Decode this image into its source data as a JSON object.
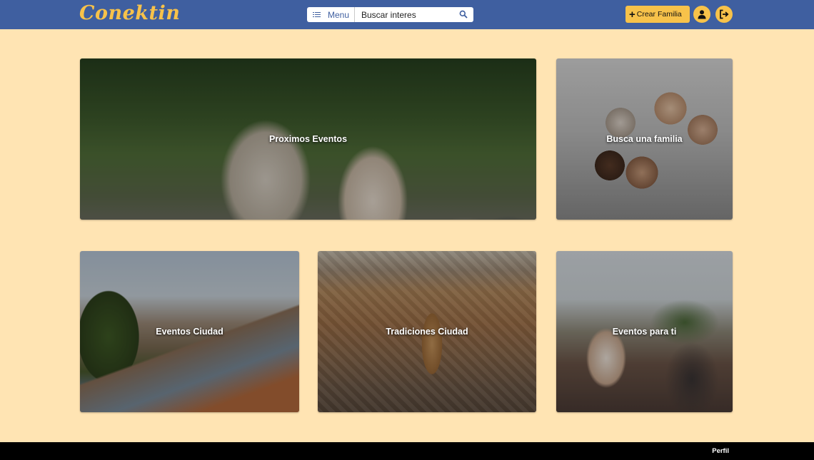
{
  "header": {
    "logo": "Conektin",
    "menu_label": "Menu",
    "search_placeholder": "Buscar interes",
    "crear_label": "Crear Familia",
    "icons": {
      "menu": "list-icon",
      "search": "search-icon",
      "crear": "plus-icon",
      "profile": "user-icon",
      "logout": "logout-icon"
    }
  },
  "cards": [
    {
      "title": "Proximos Eventos"
    },
    {
      "title": "Busca una familia"
    },
    {
      "title": "Eventos Ciudad"
    },
    {
      "title": "Tradiciones Ciudad"
    },
    {
      "title": "Eventos para ti"
    }
  ],
  "footer": {
    "link": "Perfil"
  },
  "colors": {
    "header": "#3f5fa0",
    "accent": "#f7c24a",
    "page_bg": "#ffe4b3",
    "footer": "#000000"
  }
}
